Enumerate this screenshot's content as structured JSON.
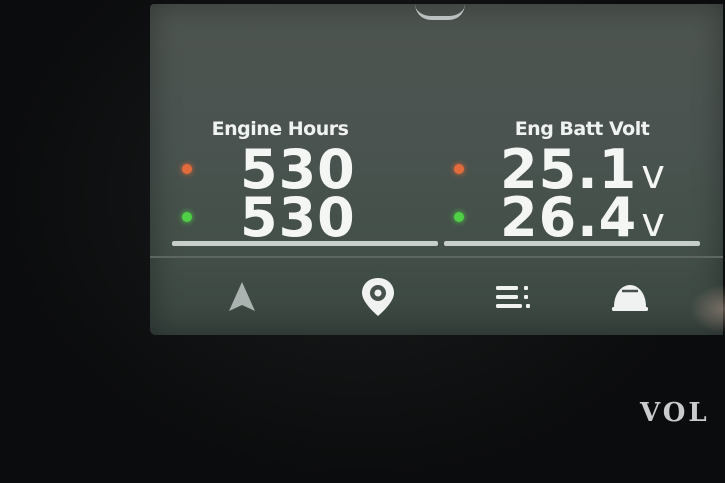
{
  "engine_hours": {
    "label": "Engine Hours",
    "rows": [
      {
        "status": "orange",
        "value": "530"
      },
      {
        "status": "green",
        "value": "530"
      }
    ]
  },
  "batt_volt": {
    "label": "Eng Batt Volt",
    "unit": "v",
    "rows": [
      {
        "status": "orange",
        "value": "25.1"
      },
      {
        "status": "green",
        "value": "26.4"
      }
    ]
  },
  "nav": {
    "items": [
      {
        "icon": "navigation-arrow-icon"
      },
      {
        "icon": "location-pin-icon"
      },
      {
        "icon": "menu-list-icon"
      },
      {
        "icon": "engine-gauge-icon"
      }
    ]
  },
  "colors": {
    "orange": "#e36a3b",
    "green": "#4fd046",
    "screen": "#4a5350"
  },
  "brand": "VOL"
}
